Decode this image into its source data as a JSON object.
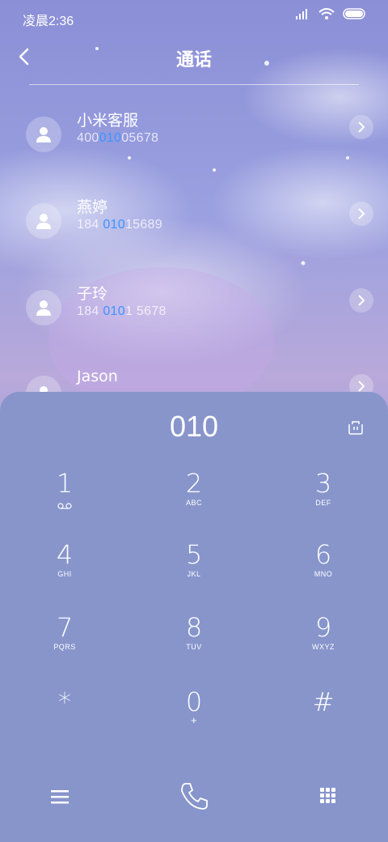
{
  "status": {
    "time": "凌晨2:36"
  },
  "header": {
    "title": "通话"
  },
  "contacts": [
    {
      "name": "小米客服",
      "num_pre": "400",
      "num_hl": "010",
      "num_post": "05678"
    },
    {
      "name": "燕婷",
      "num_pre": "184 ",
      "num_hl": "010",
      "num_post": "15689"
    },
    {
      "name": "子玲",
      "num_pre": "184 ",
      "num_hl": "010",
      "num_post": "1 5678"
    },
    {
      "name": "Jason",
      "num_pre": "",
      "num_hl": "",
      "num_post": ""
    }
  ],
  "dialpad": {
    "entered": "010",
    "keys": [
      {
        "digit": "1",
        "letters": ""
      },
      {
        "digit": "2",
        "letters": "ABC"
      },
      {
        "digit": "3",
        "letters": "DEF"
      },
      {
        "digit": "4",
        "letters": "GHI"
      },
      {
        "digit": "5",
        "letters": "JKL"
      },
      {
        "digit": "6",
        "letters": "MNO"
      },
      {
        "digit": "7",
        "letters": "PQRS"
      },
      {
        "digit": "8",
        "letters": "TUV"
      },
      {
        "digit": "9",
        "letters": "WXYZ"
      },
      {
        "digit": "*",
        "letters": ""
      },
      {
        "digit": "0",
        "letters": "+"
      },
      {
        "digit": "#",
        "letters": ""
      }
    ]
  },
  "colors": {
    "accent": "#3b95ff",
    "dialpad_bg": "#8795cb"
  },
  "icons": [
    "back-icon",
    "person-icon",
    "chevron-right-icon",
    "delete-icon",
    "voicemail-icon",
    "menu-icon",
    "phone-icon",
    "keypad-icon",
    "signal-icon",
    "wifi-icon",
    "battery-icon"
  ]
}
